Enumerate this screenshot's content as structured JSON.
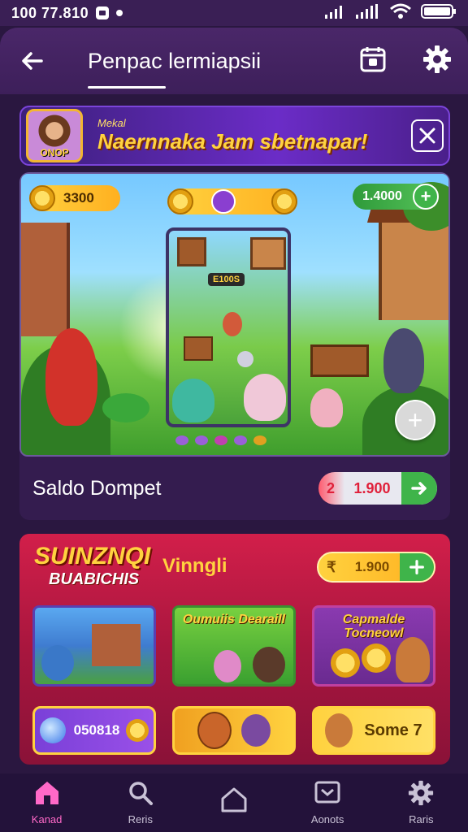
{
  "status": {
    "time": "100 77.810",
    "icons": [
      "notification-icon",
      "dot-icon",
      "signal-icon",
      "signal-icon",
      "wifi-icon",
      "battery-icon"
    ]
  },
  "appbar": {
    "title": "Penpac lermiapsii",
    "icons": [
      "back-arrow-icon",
      "calendar-icon",
      "gear-icon"
    ]
  },
  "banner": {
    "small": "Mekal",
    "big": "Naernnaka Jam sbetnapar!",
    "avatar_caption": "ONOP",
    "close_icon": "close-icon"
  },
  "game": {
    "coins_left": "3300",
    "coins_right": "1.4000",
    "screen_tag": "E100S"
  },
  "wallet": {
    "label": "Saldo Dompet",
    "currency": "2",
    "amount": "1.900"
  },
  "promo": {
    "logo_line1": "SUINZNQI",
    "logo_line2": "BUABICHIS",
    "title": "Vinngli",
    "pill_currency": "₹",
    "pill_amount": "1.900",
    "tiles": [
      {
        "caption": ""
      },
      {
        "caption": "Oumuiis Dearaill"
      },
      {
        "caption": "Capmalde Tocneowl"
      }
    ],
    "bottom_tiles": [
      {
        "label": "050818"
      },
      {
        "label": ""
      },
      {
        "label": "Some 7"
      }
    ]
  },
  "nav": [
    {
      "label": "Kanad",
      "icon": "home-icon",
      "active": true
    },
    {
      "label": "Reris",
      "icon": "search-icon",
      "active": false
    },
    {
      "label": "",
      "icon": "home-outline-icon",
      "active": false
    },
    {
      "label": "Aonots",
      "icon": "inbox-icon",
      "active": false
    },
    {
      "label": "Raris",
      "icon": "gear-icon",
      "active": false
    }
  ],
  "colors": {
    "background": "#2a1740",
    "accent_pink": "#ff69c8",
    "gold": "#ffd23f",
    "green": "#3fb44a",
    "red": "#d21f4a"
  }
}
